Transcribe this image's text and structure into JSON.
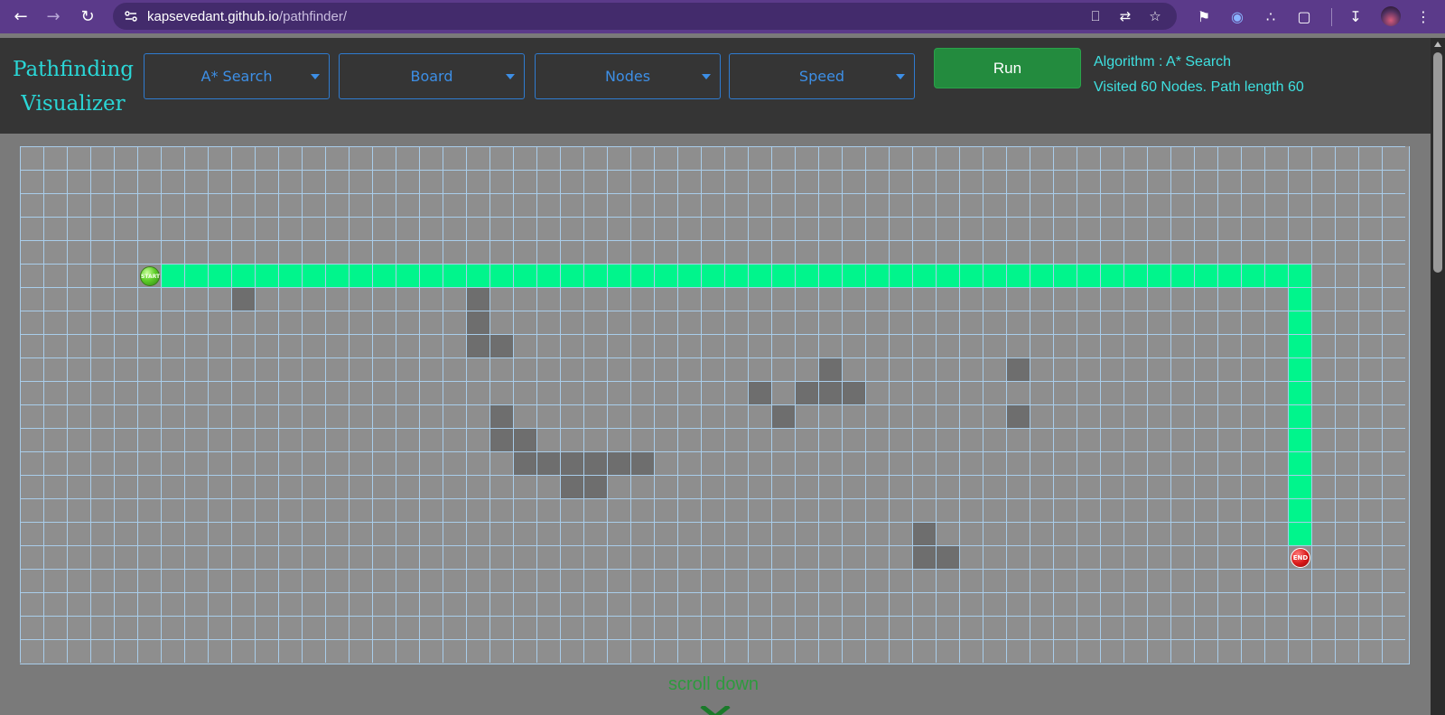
{
  "browser": {
    "url_host": "kapsevedant.github.io",
    "url_path": "/pathfinder/",
    "back_icon": "arrow-left-icon",
    "forward_icon": "arrow-right-icon",
    "reload_icon": "reload-icon"
  },
  "app": {
    "title_line1": "Pathfinding",
    "title_line2": "Visualizer",
    "dropdowns": {
      "algorithm": "A* Search",
      "board": "Board",
      "nodes": "Nodes",
      "speed": "Speed"
    },
    "run_label": "Run",
    "status_algorithm": "Algorithm : A* Search",
    "status_result": "Visited 60 Nodes. Path length 60",
    "scroll_hint": "scroll down"
  },
  "grid": {
    "cols": 59,
    "rows": 22,
    "start": {
      "col": 5,
      "row": 5,
      "label": "START"
    },
    "end": {
      "col": 54,
      "row": 17,
      "label": "END"
    },
    "walls": [
      [
        9,
        6
      ],
      [
        19,
        6
      ],
      [
        19,
        7
      ],
      [
        19,
        8
      ],
      [
        20,
        8
      ],
      [
        20,
        11
      ],
      [
        20,
        12
      ],
      [
        21,
        12
      ],
      [
        21,
        13
      ],
      [
        22,
        13
      ],
      [
        23,
        13
      ],
      [
        24,
        13
      ],
      [
        25,
        13
      ],
      [
        26,
        13
      ],
      [
        23,
        14
      ],
      [
        24,
        14
      ],
      [
        34,
        9
      ],
      [
        33,
        10
      ],
      [
        34,
        10
      ],
      [
        35,
        10
      ],
      [
        31,
        10
      ],
      [
        32,
        11
      ],
      [
        42,
        9
      ],
      [
        42,
        11
      ],
      [
        38,
        16
      ],
      [
        38,
        17
      ],
      [
        39,
        17
      ]
    ],
    "path": {
      "row": 5,
      "from_col": 6,
      "to_col": 54,
      "col": 54,
      "from_row": 5,
      "to_row": 16
    }
  },
  "colors": {
    "path": "#00f58c",
    "wall": "#6e6e6e",
    "grid_line": "#a9cdea",
    "accent_cyan": "#2ad6d6",
    "run_green": "#238b3e"
  }
}
